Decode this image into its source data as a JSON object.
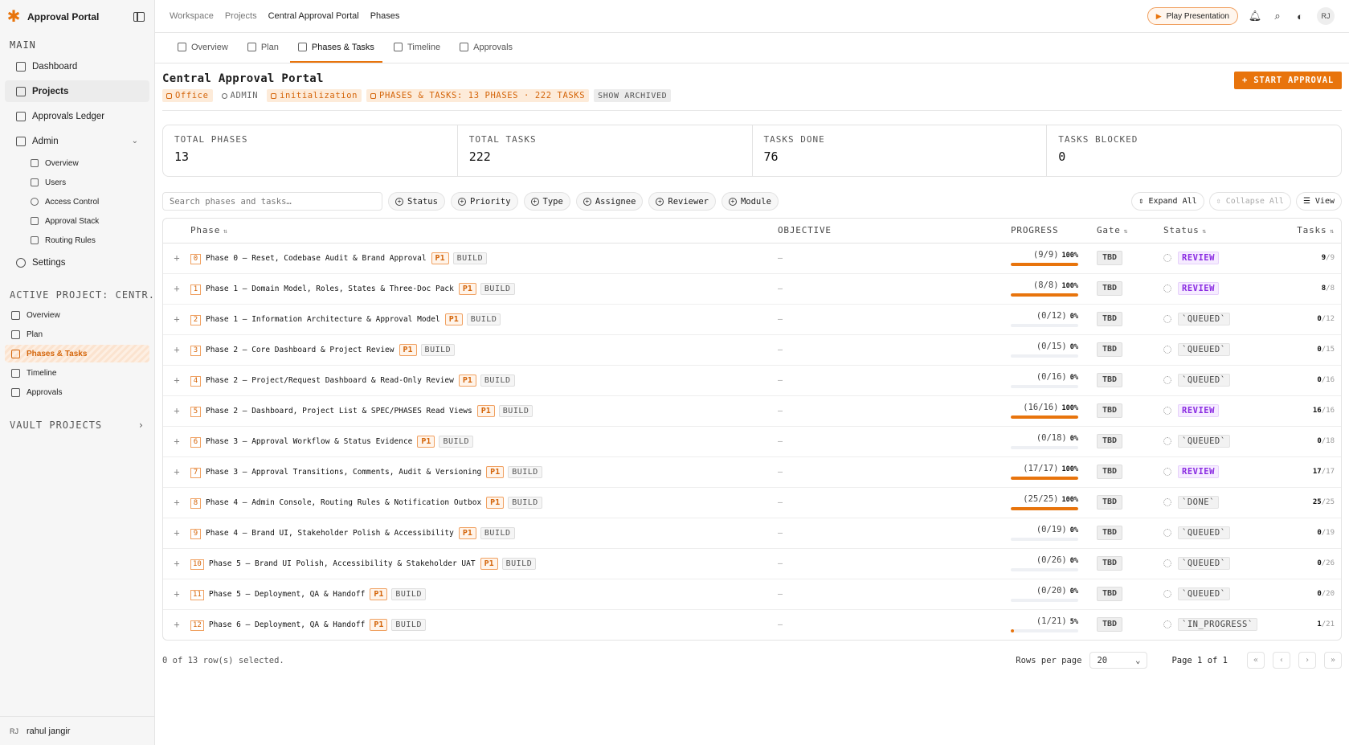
{
  "app": {
    "name": "Approval Portal"
  },
  "sidebar": {
    "main_label": "MAIN",
    "items": [
      {
        "label": "Dashboard"
      },
      {
        "label": "Projects"
      },
      {
        "label": "Approvals Ledger"
      },
      {
        "label": "Admin"
      }
    ],
    "admin_sub": [
      {
        "label": "Overview"
      },
      {
        "label": "Users"
      },
      {
        "label": "Access Control"
      },
      {
        "label": "Approval Stack"
      },
      {
        "label": "Routing Rules"
      }
    ],
    "settings_label": "Settings",
    "active_project_label": "ACTIVE PROJECT: CENTR...",
    "project_items": [
      {
        "label": "Overview"
      },
      {
        "label": "Plan"
      },
      {
        "label": "Phases & Tasks"
      },
      {
        "label": "Timeline"
      },
      {
        "label": "Approvals"
      }
    ],
    "vault_label": "VAULT PROJECTS",
    "user": {
      "initials": "RJ",
      "name": "rahul jangir"
    }
  },
  "topbar": {
    "breadcrumbs": [
      "Workspace",
      "Projects",
      "Central Approval Portal",
      "Phases"
    ],
    "play_label": "Play Presentation",
    "avatar": "RJ"
  },
  "tabs": [
    {
      "label": "Overview"
    },
    {
      "label": "Plan"
    },
    {
      "label": "Phases & Tasks"
    },
    {
      "label": "Timeline"
    },
    {
      "label": "Approvals"
    }
  ],
  "page": {
    "title": "Central Approval Portal",
    "start_label": "+ START APPROVAL",
    "badges": {
      "office": "Office",
      "admin": "ADMIN",
      "initialization": "initialization",
      "summary": "PHASES & TASKS: 13 PHASES · 222 TASKS",
      "archived": "SHOW ARCHIVED"
    }
  },
  "stats": [
    {
      "label": "TOTAL PHASES",
      "value": "13"
    },
    {
      "label": "TOTAL TASKS",
      "value": "222"
    },
    {
      "label": "TASKS DONE",
      "value": "76"
    },
    {
      "label": "TASKS BLOCKED",
      "value": "0"
    }
  ],
  "toolbar": {
    "search_placeholder": "Search phases and tasks…",
    "filters": [
      "Status",
      "Priority",
      "Type",
      "Assignee",
      "Reviewer",
      "Module"
    ],
    "expand_label": "Expand All",
    "collapse_label": "Collapse All",
    "view_label": "View"
  },
  "table": {
    "headers": {
      "phase": "Phase",
      "objective": "OBJECTIVE",
      "progress": "PROGRESS",
      "gate": "Gate",
      "status": "Status",
      "tasks": "Tasks"
    },
    "rows": [
      {
        "idx": "0",
        "name": "Phase 0 — Reset, Codebase Audit & Brand Approval",
        "priority": "P1",
        "type": "BUILD",
        "objective": "—",
        "progress": "(9/9)",
        "pct_label": "100%",
        "pct": 100,
        "gate": "TBD",
        "status": "REVIEW",
        "status_kind": "review",
        "done": "9",
        "total": "/9"
      },
      {
        "idx": "1",
        "name": "Phase 1 — Domain Model, Roles, States & Three-Doc Pack",
        "priority": "P1",
        "type": "BUILD",
        "objective": "—",
        "progress": "(8/8)",
        "pct_label": "100%",
        "pct": 100,
        "gate": "TBD",
        "status": "REVIEW",
        "status_kind": "review",
        "done": "8",
        "total": "/8"
      },
      {
        "idx": "2",
        "name": "Phase 1 — Information Architecture & Approval Model",
        "priority": "P1",
        "type": "BUILD",
        "objective": "—",
        "progress": "(0/12)",
        "pct_label": "0%",
        "pct": 0,
        "gate": "TBD",
        "status": "`QUEUED`",
        "status_kind": "other",
        "done": "0",
        "total": "/12"
      },
      {
        "idx": "3",
        "name": "Phase 2 — Core Dashboard & Project Review",
        "priority": "P1",
        "type": "BUILD",
        "objective": "—",
        "progress": "(0/15)",
        "pct_label": "0%",
        "pct": 0,
        "gate": "TBD",
        "status": "`QUEUED`",
        "status_kind": "other",
        "done": "0",
        "total": "/15"
      },
      {
        "idx": "4",
        "name": "Phase 2 — Project/Request Dashboard & Read-Only Review",
        "priority": "P1",
        "type": "BUILD",
        "objective": "—",
        "progress": "(0/16)",
        "pct_label": "0%",
        "pct": 0,
        "gate": "TBD",
        "status": "`QUEUED`",
        "status_kind": "other",
        "done": "0",
        "total": "/16"
      },
      {
        "idx": "5",
        "name": "Phase 2 — Dashboard, Project List & SPEC/PHASES Read Views",
        "priority": "P1",
        "type": "BUILD",
        "objective": "—",
        "progress": "(16/16)",
        "pct_label": "100%",
        "pct": 100,
        "gate": "TBD",
        "status": "REVIEW",
        "status_kind": "review",
        "done": "16",
        "total": "/16"
      },
      {
        "idx": "6",
        "name": "Phase 3 — Approval Workflow & Status Evidence",
        "priority": "P1",
        "type": "BUILD",
        "objective": "—",
        "progress": "(0/18)",
        "pct_label": "0%",
        "pct": 0,
        "gate": "TBD",
        "status": "`QUEUED`",
        "status_kind": "other",
        "done": "0",
        "total": "/18"
      },
      {
        "idx": "7",
        "name": "Phase 3 — Approval Transitions, Comments, Audit & Versioning",
        "priority": "P1",
        "type": "BUILD",
        "objective": "—",
        "progress": "(17/17)",
        "pct_label": "100%",
        "pct": 100,
        "gate": "TBD",
        "status": "REVIEW",
        "status_kind": "review",
        "done": "17",
        "total": "/17"
      },
      {
        "idx": "8",
        "name": "Phase 4 — Admin Console, Routing Rules & Notification Outbox",
        "priority": "P1",
        "type": "BUILD",
        "objective": "—",
        "progress": "(25/25)",
        "pct_label": "100%",
        "pct": 100,
        "gate": "TBD",
        "status": "`DONE`",
        "status_kind": "other",
        "done": "25",
        "total": "/25"
      },
      {
        "idx": "9",
        "name": "Phase 4 — Brand UI, Stakeholder Polish & Accessibility",
        "priority": "P1",
        "type": "BUILD",
        "objective": "—",
        "progress": "(0/19)",
        "pct_label": "0%",
        "pct": 0,
        "gate": "TBD",
        "status": "`QUEUED`",
        "status_kind": "other",
        "done": "0",
        "total": "/19"
      },
      {
        "idx": "10",
        "name": "Phase 5 — Brand UI Polish, Accessibility & Stakeholder UAT",
        "priority": "P1",
        "type": "BUILD",
        "objective": "—",
        "progress": "(0/26)",
        "pct_label": "0%",
        "pct": 0,
        "gate": "TBD",
        "status": "`QUEUED`",
        "status_kind": "other",
        "done": "0",
        "total": "/26"
      },
      {
        "idx": "11",
        "name": "Phase 5 — Deployment, QA & Handoff",
        "priority": "P1",
        "type": "BUILD",
        "objective": "—",
        "progress": "(0/20)",
        "pct_label": "0%",
        "pct": 0,
        "gate": "TBD",
        "status": "`QUEUED`",
        "status_kind": "other",
        "done": "0",
        "total": "/20"
      },
      {
        "idx": "12",
        "name": "Phase 6 — Deployment, QA & Handoff",
        "priority": "P1",
        "type": "BUILD",
        "objective": "—",
        "progress": "(1/21)",
        "pct_label": "5%",
        "pct": 5,
        "gate": "TBD",
        "status": "`IN_PROGRESS`",
        "status_kind": "other",
        "done": "1",
        "total": "/21"
      }
    ]
  },
  "footer": {
    "selection": "0 of 13 row(s) selected.",
    "rpp_label": "Rows per page",
    "rpp_value": "20",
    "page_info": "Page 1 of 1"
  },
  "colors": {
    "accent": "#e8740c",
    "review": "#8a2be2"
  }
}
